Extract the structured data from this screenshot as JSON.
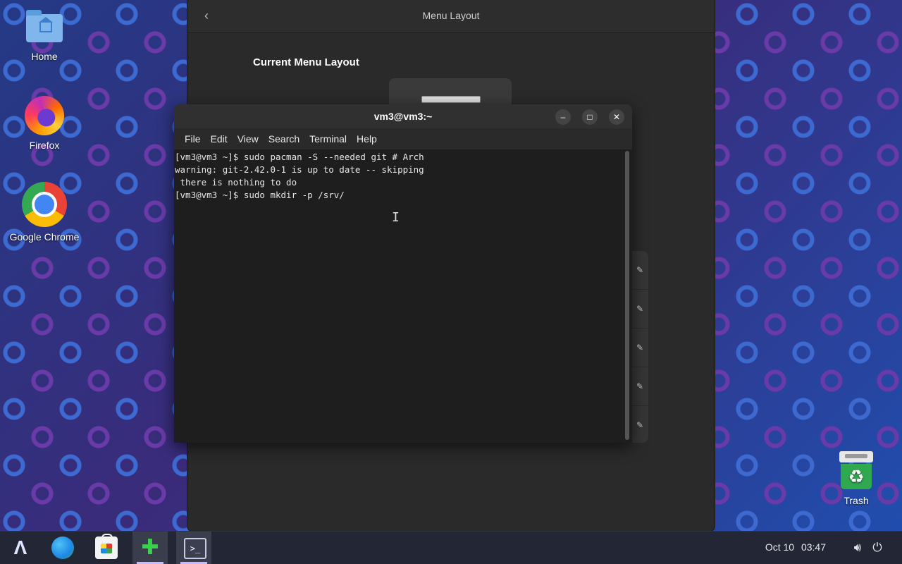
{
  "desktop": {
    "icons": [
      {
        "label": "Home",
        "icon": "home-folder-icon"
      },
      {
        "label": "Firefox",
        "icon": "firefox-icon"
      },
      {
        "label": "Google Chrome",
        "icon": "chrome-icon"
      },
      {
        "label": "Trash",
        "icon": "trash-icon"
      }
    ]
  },
  "settings": {
    "title": "Menu Layout",
    "section_title": "Current Menu Layout"
  },
  "terminal": {
    "title": "vm3@vm3:~",
    "menu": [
      "File",
      "Edit",
      "View",
      "Search",
      "Terminal",
      "Help"
    ],
    "lines": [
      "[vm3@vm3 ~]$ sudo pacman -S --needed git # Arch",
      "warning: git-2.42.0-1 is up to date -- skipping",
      " there is nothing to do",
      "[vm3@vm3 ~]$ sudo mkdir -p /srv/"
    ]
  },
  "taskbar": {
    "apps": [
      "arch-menu-icon",
      "browser-icon",
      "software-store-icon",
      "extensions-icon",
      "terminal-icon"
    ],
    "date": "Oct 10",
    "time": "03:47"
  }
}
